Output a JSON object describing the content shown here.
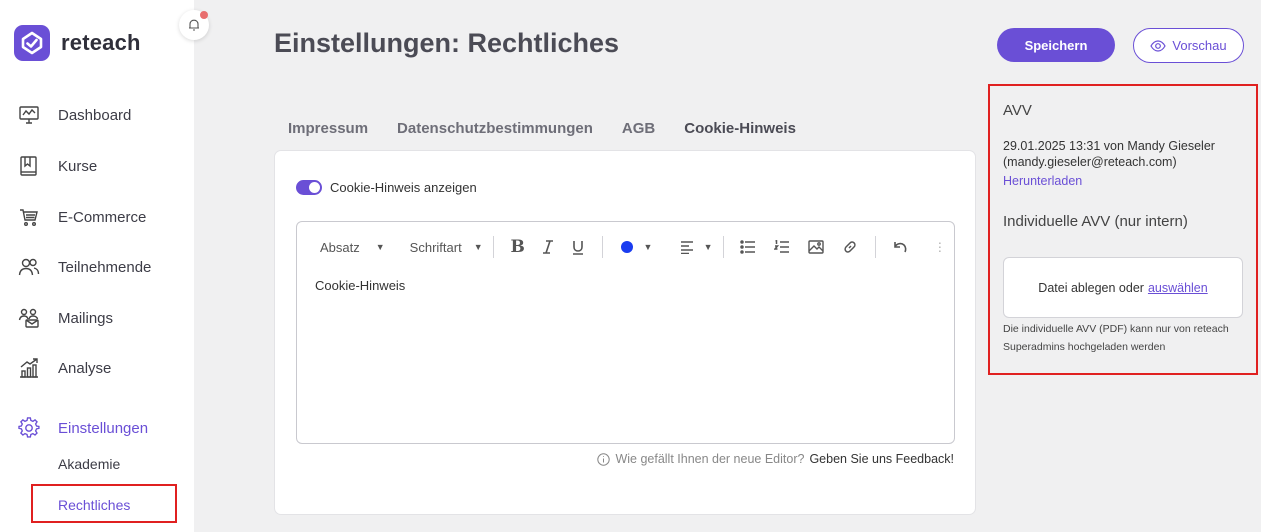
{
  "app": {
    "logo_text": "reteach",
    "brand_color": "#6a4fd6"
  },
  "sidebar": {
    "items": [
      {
        "label": "Dashboard",
        "icon": "dashboard-icon"
      },
      {
        "label": "Kurse",
        "icon": "book-icon"
      },
      {
        "label": "E-Commerce",
        "icon": "cart-icon"
      },
      {
        "label": "Teilnehmende",
        "icon": "users-icon"
      },
      {
        "label": "Mailings",
        "icon": "mailing-icon"
      },
      {
        "label": "Analyse",
        "icon": "analytics-icon"
      },
      {
        "label": "Einstellungen",
        "icon": "gear-icon",
        "active": true
      }
    ],
    "subitems": [
      {
        "label": "Akademie"
      },
      {
        "label": "Rechtliches",
        "active": true
      }
    ]
  },
  "header": {
    "title": "Einstellungen: Rechtliches",
    "save_label": "Speichern",
    "preview_label": "Vorschau"
  },
  "tabs": [
    {
      "label": "Impressum"
    },
    {
      "label": "Datenschutzbestimmungen"
    },
    {
      "label": "AGB"
    },
    {
      "label": "Cookie-Hinweis",
      "active": true
    }
  ],
  "cookie": {
    "toggle_label": "Cookie-Hinweis anzeigen",
    "toggle_on": true
  },
  "editor": {
    "paragraph_select": "Absatz",
    "font_select": "Schriftart",
    "text_color": "#1a3cf0",
    "content": "Cookie-Hinweis",
    "feedback_question": "Wie gefällt Ihnen der neue Editor?",
    "feedback_link": "Geben Sie uns Feedback!"
  },
  "avv_panel": {
    "title": "AVV",
    "meta_line1": "29.01.2025 13:31 von Mandy Gieseler",
    "meta_line2": "(mandy.gieseler@reteach.com)",
    "download_label": "Herunterladen",
    "subtitle": "Individuelle AVV (nur intern)",
    "dropzone_text": "Datei ablegen oder",
    "dropzone_link": "auswählen",
    "hint": "Die individuelle AVV (PDF) kann nur von reteach Superadmins hochgeladen werden"
  }
}
